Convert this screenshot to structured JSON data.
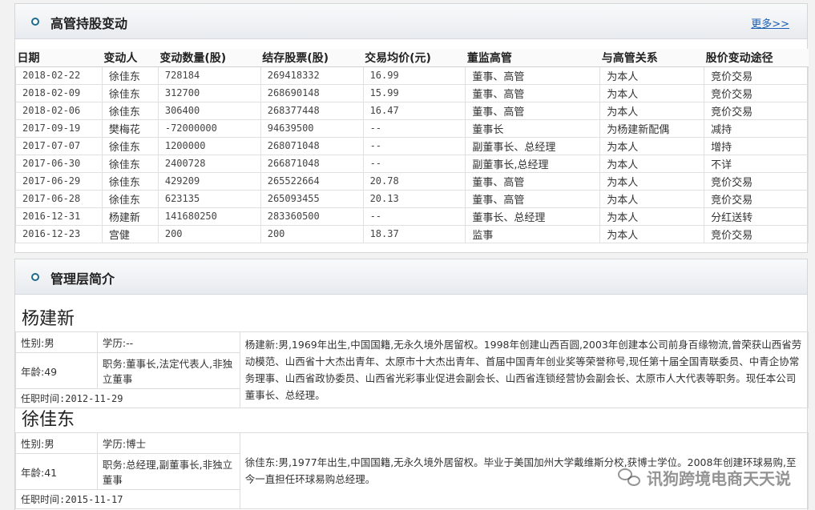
{
  "trades_section": {
    "title": "高管持股变动",
    "more_link": "更多>>",
    "columns": [
      "日期",
      "变动人",
      "变动数量(股)",
      "结存股票(股)",
      "交易均价(元)",
      "董监高管",
      "与高管关系",
      "股价变动途径"
    ],
    "rows": [
      [
        "2018-02-22",
        "徐佳东",
        "728184",
        "269418332",
        "16.99",
        "董事、高管",
        "为本人",
        "竞价交易"
      ],
      [
        "2018-02-09",
        "徐佳东",
        "312700",
        "268690148",
        "15.99",
        "董事、高管",
        "为本人",
        "竞价交易"
      ],
      [
        "2018-02-06",
        "徐佳东",
        "306400",
        "268377448",
        "16.47",
        "董事、高管",
        "为本人",
        "竞价交易"
      ],
      [
        "2017-09-19",
        "樊梅花",
        "-72000000",
        "94639500",
        "--",
        "董事长",
        "为杨建新配偶",
        "减持"
      ],
      [
        "2017-07-07",
        "徐佳东",
        "1200000",
        "268071048",
        "--",
        "副董事长、总经理",
        "为本人",
        "增持"
      ],
      [
        "2017-06-30",
        "徐佳东",
        "2400728",
        "266871048",
        "--",
        "副董事长,总经理",
        "为本人",
        "不详"
      ],
      [
        "2017-06-29",
        "徐佳东",
        "429209",
        "265522664",
        "20.78",
        "董事、高管",
        "为本人",
        "竞价交易"
      ],
      [
        "2017-06-28",
        "徐佳东",
        "623135",
        "265093455",
        "20.13",
        "董事、高管",
        "为本人",
        "竞价交易"
      ],
      [
        "2016-12-31",
        "杨建新",
        "141680250",
        "283360500",
        "--",
        "董事长、总经理",
        "为本人",
        "分红送转"
      ],
      [
        "2016-12-23",
        "宫健",
        "200",
        "200",
        "18.37",
        "监事",
        "为本人",
        "竞价交易"
      ]
    ]
  },
  "mgmt_section": {
    "title": "管理层简介",
    "people": [
      {
        "name": "杨建新",
        "gender": "性别:男",
        "education": "学历:--",
        "age": "年龄:49",
        "position": "职务:董事长,法定代表人,非独立董事",
        "tenure": "任职时间:2012-11-29",
        "bio": "杨建新:男,1969年出生,中国国籍,无永久境外居留权。1998年创建山西百圆,2003年创建本公司前身百缘物流,曾荣获山西省劳动模范、山西省十大杰出青年、太原市十大杰出青年、首届中国青年创业奖等荣誉称号,现任第十届全国青联委员、中青企协常务理事、山西省政协委员、山西省光彩事业促进会副会长、山西省连锁经营协会副会长、太原市人大代表等职务。现任本公司董事长、总经理。"
      },
      {
        "name": "徐佳东",
        "gender": "性别:男",
        "education": "学历:博士",
        "age": "年龄:41",
        "position": "职务:总经理,副董事长,非独立董事",
        "tenure": "任职时间:2015-11-17",
        "bio": "徐佳东:男,1977年出生,中国国籍,无永久境外居留权。毕业于美国加州大学戴维斯分校,获博士学位。2008年创建环球易购,至今一直担任环球易购总经理。"
      }
    ]
  },
  "watermark": "讯狗跨境电商天天说"
}
